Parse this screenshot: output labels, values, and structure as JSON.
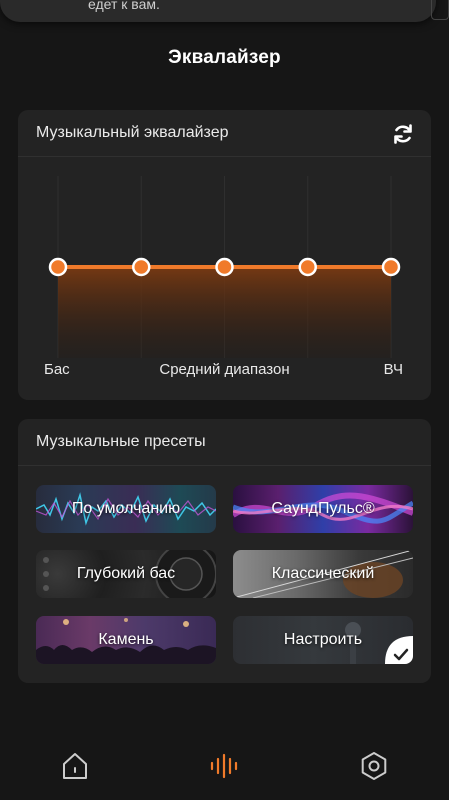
{
  "notification": {
    "text": "едет к вам."
  },
  "header": {
    "title": "Эквалайзер"
  },
  "equalizer": {
    "title": "Музыкальный эквалайзер",
    "bands": [
      {
        "label": "Бас",
        "level": 0
      },
      {
        "label": "",
        "level": 0
      },
      {
        "label": "Средний диапазон",
        "level": 0
      },
      {
        "label": "",
        "level": 0
      },
      {
        "label": "ВЧ",
        "level": 0
      }
    ],
    "accent": "#f07a2a"
  },
  "presets": {
    "title": "Музыкальные пресеты",
    "items": [
      {
        "label": "По умолчанию"
      },
      {
        "label": "СаундПульс®"
      },
      {
        "label": "Глубокий бас"
      },
      {
        "label": "Классический"
      },
      {
        "label": "Камень"
      },
      {
        "label": "Настроить",
        "selected": true
      }
    ]
  },
  "tabbar": {
    "items": [
      {
        "icon": "home-icon"
      },
      {
        "icon": "equalizer-bars-icon",
        "active": true
      },
      {
        "icon": "settings-hex-icon"
      }
    ],
    "active_color": "#f07a2a",
    "inactive_color": "#cccccc"
  }
}
